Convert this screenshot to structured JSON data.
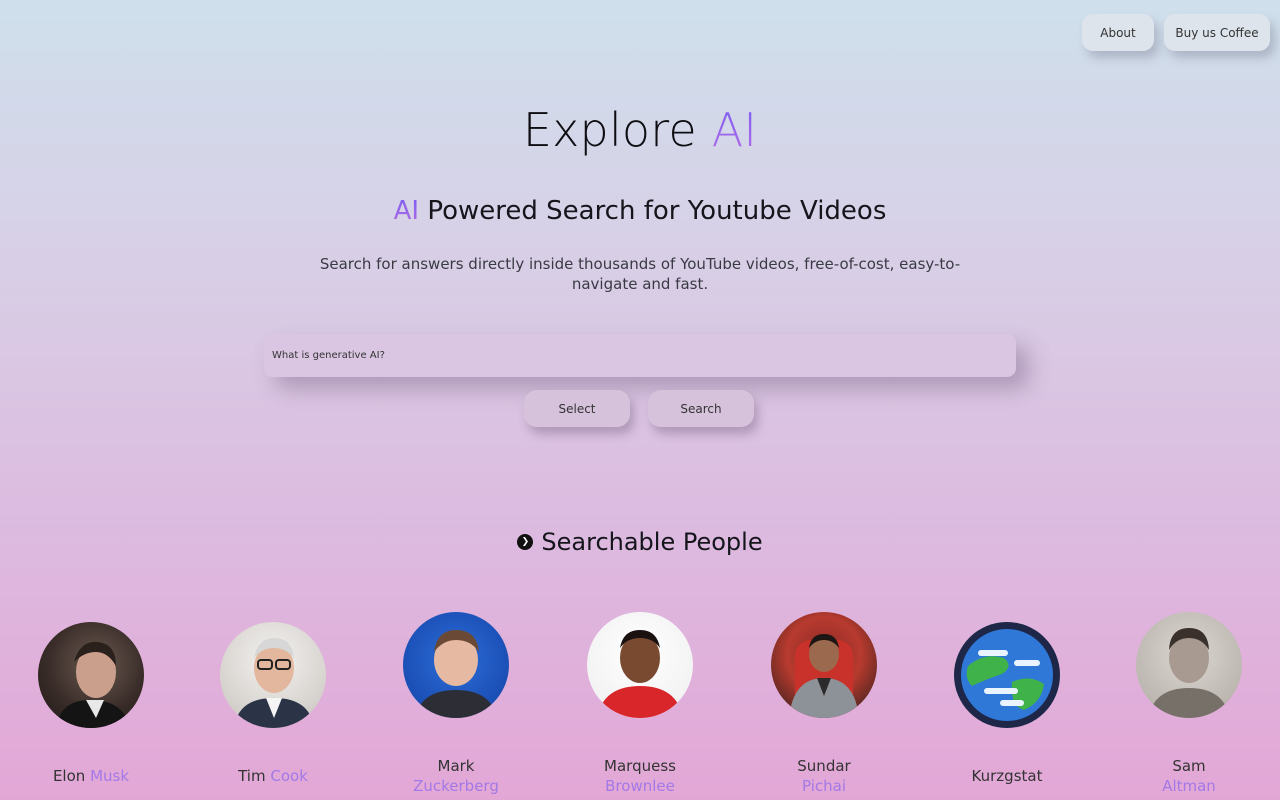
{
  "nav": {
    "about_label": "About",
    "coffee_label": "Buy us Coffee"
  },
  "hero": {
    "title_main": "Explore",
    "title_accent": "AI",
    "subtitle_accent": "AI",
    "subtitle_main": "Powered Search for Youtube Videos",
    "description": "Search for answers directly inside thousands of YouTube videos, free-of-cost, easy-to-navigate and fast."
  },
  "search": {
    "placeholder": "What is generative AI?",
    "select_label": "Select",
    "search_label": "Search"
  },
  "section": {
    "icon": "chevron-right-circle-icon",
    "title": "Searchable People"
  },
  "people": [
    {
      "first": "Elon",
      "last": "Musk",
      "layout": "inline"
    },
    {
      "first": "Tim",
      "last": "Cook",
      "layout": "inline"
    },
    {
      "first": "Mark",
      "last": "Zuckerberg",
      "layout": "stacked"
    },
    {
      "first": "Marquess",
      "last": "Brownlee",
      "layout": "stacked"
    },
    {
      "first": "Sundar",
      "last": "Pichai",
      "layout": "stacked"
    },
    {
      "first": "Kurzgstat",
      "last": "",
      "layout": "inline"
    },
    {
      "first": "Sam",
      "last": "Altman",
      "layout": "stacked"
    }
  ],
  "colors": {
    "accent": "#a279e6",
    "background_top": "#cfe0ec",
    "background_bottom": "#e3a7d6"
  }
}
